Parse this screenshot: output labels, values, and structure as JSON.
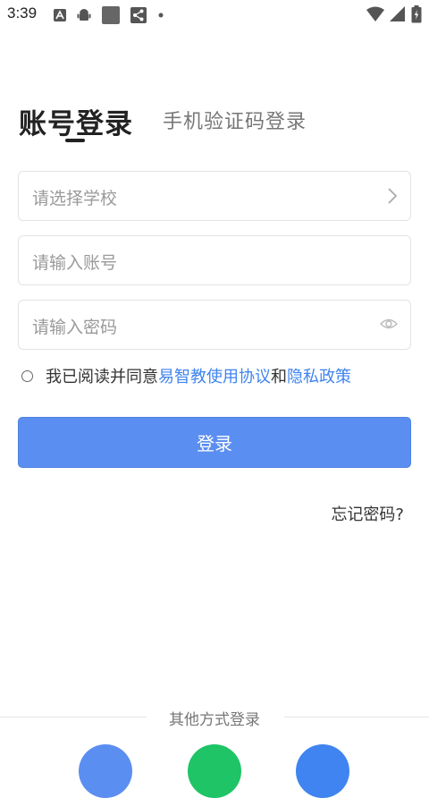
{
  "status_bar": {
    "time": "3:39",
    "icons": [
      "a-notification-icon",
      "android-icon",
      "square-notification-icon",
      "share-icon",
      "dot-icon",
      "wifi-icon",
      "signal-icon",
      "battery-icon"
    ]
  },
  "tabs": {
    "active": "账号登录",
    "inactive": "手机验证码登录"
  },
  "form": {
    "school_placeholder": "请选择学校",
    "account_placeholder": "请输入账号",
    "password_placeholder": "请输入密码"
  },
  "agreement": {
    "prefix": "我已阅读并同意",
    "terms_link": "易智教使用协议",
    "and": "和",
    "privacy_link": "隐私政策"
  },
  "login_button": "登录",
  "forgot_password": "忘记密码?",
  "other_login": {
    "title": "其他方式登录",
    "options": [
      "social-login-blue-icon",
      "wechat-icon",
      "social-login-blue-2-icon"
    ]
  },
  "colors": {
    "primary": "#5b8ef1",
    "link": "#3f84f0",
    "wechat": "#1ec466"
  }
}
